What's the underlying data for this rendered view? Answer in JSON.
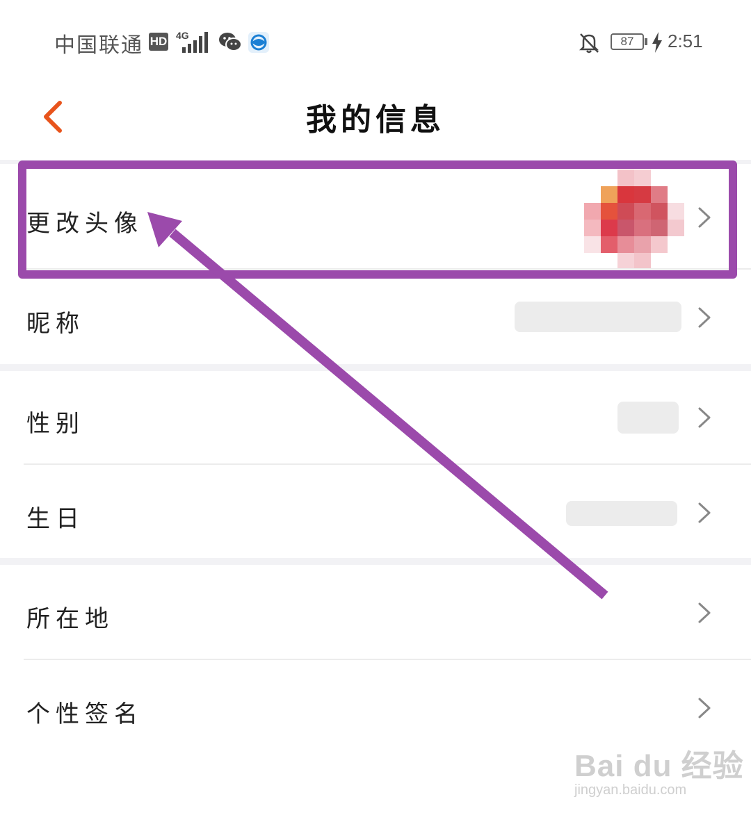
{
  "status_bar": {
    "carrier": "中国联通",
    "hd_badge": "HD",
    "network": "4G",
    "battery_level": "87",
    "time": "2:51",
    "icons": [
      "hd-badge",
      "signal-icon",
      "wechat-icon",
      "browser-icon",
      "mute-bell-icon",
      "battery-icon",
      "charging-icon"
    ]
  },
  "header": {
    "title": "我的信息",
    "back_icon": "chevron-left-icon"
  },
  "rows": [
    {
      "label": "更改头像",
      "value_type": "avatar"
    },
    {
      "label": "昵称",
      "value_type": "blurred"
    },
    {
      "label": "性别",
      "value_type": "blurred"
    },
    {
      "label": "生日",
      "value_type": "blurred"
    },
    {
      "label": "所在地",
      "value_type": "none"
    },
    {
      "label": "个性签名",
      "value_type": "none"
    }
  ],
  "annotation": {
    "highlight_color": "#9b4aab"
  },
  "colors": {
    "accent": "#e8541c",
    "annotation": "#9b4aab"
  },
  "watermark": {
    "logo": "Bai du 经验",
    "url": "jingyan.baidu.com"
  }
}
